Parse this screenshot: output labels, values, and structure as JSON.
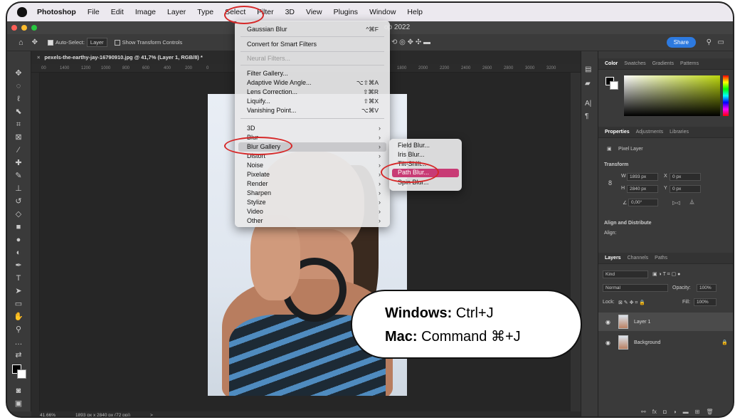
{
  "menubar": {
    "items": [
      "Photoshop",
      "File",
      "Edit",
      "Image",
      "Layer",
      "Type",
      "Select",
      "Filter",
      "3D",
      "View",
      "Plugins",
      "Window",
      "Help"
    ]
  },
  "titlebar": {
    "text": "op 2022"
  },
  "options": {
    "auto_select_label": "Auto-Select:",
    "auto_select_value": "Layer",
    "transform_label": "Show Transform Controls",
    "share": "Share"
  },
  "document": {
    "tab": "pexels-the-earthy-jay-16790910.jpg @ 41,7% (Layer 1, RGB/8) *",
    "ruler_left": [
      "00",
      "1400",
      "1200",
      "1000",
      "800",
      "600",
      "400",
      "200",
      "0"
    ],
    "ruler_right": [
      "1800",
      "2000",
      "2200",
      "2400",
      "2600",
      "2800",
      "3000",
      "3200"
    ],
    "zoom": "41,66%",
    "size": "1893 px x 2840 px (72 ppi)",
    "status_arrow": ">"
  },
  "filter_menu": {
    "items": [
      {
        "label": "Gaussian Blur",
        "shortcut": "^⌘F"
      },
      {
        "label": "Convert for Smart Filters"
      },
      {
        "label": "Neural Filters..."
      },
      {
        "label": "Filter Gallery..."
      },
      {
        "label": "Adaptive Wide Angle...",
        "shortcut": "⌥⇧⌘A"
      },
      {
        "label": "Lens Correction...",
        "shortcut": "⇧⌘R"
      },
      {
        "label": "Liquify...",
        "shortcut": "⇧⌘X"
      },
      {
        "label": "Vanishing Point...",
        "shortcut": "⌥⌘V"
      },
      {
        "label": "3D"
      },
      {
        "label": "Blur"
      },
      {
        "label": "Blur Gallery"
      },
      {
        "label": "Distort"
      },
      {
        "label": "Noise"
      },
      {
        "label": "Pixelate"
      },
      {
        "label": "Render"
      },
      {
        "label": "Sharpen"
      },
      {
        "label": "Stylize"
      },
      {
        "label": "Video"
      },
      {
        "label": "Other"
      }
    ]
  },
  "blur_gallery_submenu": {
    "items": [
      "Field Blur...",
      "Iris Blur...",
      "Tilt-Shift...",
      "Path Blur...",
      "Spin Blur..."
    ]
  },
  "color_panel": {
    "tabs": [
      "Color",
      "Swatches",
      "Gradients",
      "Patterns"
    ]
  },
  "properties_panel": {
    "tabs": [
      "Properties",
      "Adjustments",
      "Libraries"
    ],
    "layer_type": "Pixel Layer",
    "transform_title": "Transform",
    "w_label": "W",
    "w_value": "1893 px",
    "h_label": "H",
    "h_value": "2840 px",
    "x_label": "X",
    "x_value": "0 px",
    "y_label": "Y",
    "y_value": "0 px",
    "angle": "0,00°",
    "align_title": "Align and Distribute",
    "align_label": "Align:"
  },
  "layers_panel": {
    "tabs": [
      "Layers",
      "Channels",
      "Paths"
    ],
    "kind": "Kind",
    "blend": "Normal",
    "opacity_label": "Opacity:",
    "opacity": "100%",
    "lock_label": "Lock:",
    "fill_label": "Fill:",
    "fill": "100%",
    "layers": [
      "Layer 1",
      "Background"
    ]
  },
  "callout": {
    "win_bold": "Windows:",
    "win_keys": " Ctrl+J",
    "mac_bold": "Mac:",
    "mac_keys": " Command ⌘+J"
  }
}
